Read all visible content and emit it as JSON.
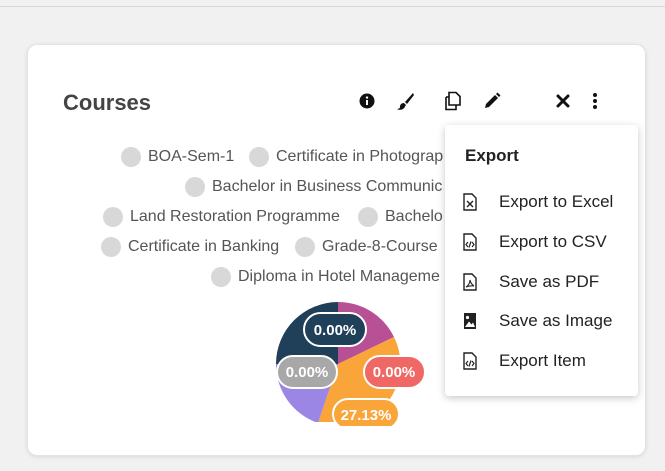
{
  "card": {
    "title": "Courses",
    "toolbar": [
      "info-icon",
      "brush-icon",
      "copy-icon",
      "pencil-icon",
      "close-icon",
      "more-vertical-icon"
    ]
  },
  "legend": {
    "items": [
      {
        "label": "BOA-Sem-1"
      },
      {
        "label": "Certificate in Photograp"
      },
      {
        "label": "Bachelor in Business Communic"
      },
      {
        "label": "Land Restoration Programme"
      },
      {
        "label": "Bachelo"
      },
      {
        "label": "Certificate in Banking"
      },
      {
        "label": "Grade-8-Course"
      },
      {
        "label": "Diploma in Hotel Manageme"
      }
    ],
    "dot_color": "#d8d8d8"
  },
  "chart_data": {
    "type": "pie",
    "data_labels": [
      "0.00%",
      "0.00%",
      "0.00%",
      "27.13%"
    ],
    "colors": {
      "navy": "#1f4058",
      "magenta": "#b85096",
      "orange": "#f9a53a",
      "purple": "#9b86e6",
      "label_navy": "#1f4058",
      "label_gray": "#a8a8a8",
      "label_red": "#f06866",
      "label_orange": "#f9a53a"
    }
  },
  "menu": {
    "title": "Export",
    "items": [
      {
        "label": "Export to Excel",
        "icon": "excel-file-icon"
      },
      {
        "label": "Export to CSV",
        "icon": "csv-file-icon"
      },
      {
        "label": "Save as PDF",
        "icon": "pdf-file-icon"
      },
      {
        "label": "Save as Image",
        "icon": "image-file-icon"
      },
      {
        "label": "Export Item",
        "icon": "code-file-icon"
      }
    ]
  }
}
